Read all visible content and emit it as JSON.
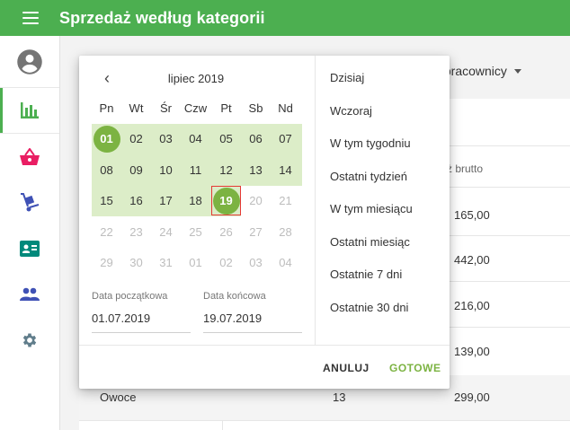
{
  "header": {
    "title": "Sprzedaż według kategorii"
  },
  "sidebar": {
    "items": [
      {
        "icon": "account-circle-icon",
        "active": false
      },
      {
        "icon": "bar-chart-icon",
        "active": true
      },
      {
        "icon": "basket-icon",
        "active": false
      },
      {
        "icon": "hand-truck-icon",
        "active": false
      },
      {
        "icon": "id-card-icon",
        "active": false
      },
      {
        "icon": "people-icon",
        "active": false
      },
      {
        "icon": "gear-icon",
        "active": false
      }
    ]
  },
  "background": {
    "employees_select": "cy pracownicy",
    "column_header": "ż brutto",
    "values": [
      "165,00",
      "442,00",
      "216,00",
      "139,00",
      "299,00"
    ],
    "last_row": {
      "category": "Owoce",
      "qty": "13",
      "value": "299,00"
    }
  },
  "calendar": {
    "month_label": "lipiec 2019",
    "prev_icon": "‹",
    "weekdays": [
      "Pn",
      "Wt",
      "Śr",
      "Czw",
      "Pt",
      "Sb",
      "Nd"
    ],
    "weeks": [
      [
        "01",
        "02",
        "03",
        "04",
        "05",
        "06",
        "07"
      ],
      [
        "08",
        "09",
        "10",
        "11",
        "12",
        "13",
        "14"
      ],
      [
        "15",
        "16",
        "17",
        "18",
        "19",
        "20",
        "21"
      ],
      [
        "22",
        "23",
        "24",
        "25",
        "26",
        "27",
        "28"
      ],
      [
        "29",
        "30",
        "31",
        "01",
        "02",
        "03",
        "04"
      ]
    ],
    "range_start": "01",
    "range_end": "19",
    "start_label": "Data początkowa",
    "start_value": "01.07.2019",
    "end_label": "Data końcowa",
    "end_value": "19.07.2019"
  },
  "presets": [
    "Dzisiaj",
    "Wczoraj",
    "W tym tygodniu",
    "Ostatni tydzień",
    "W tym miesiącu",
    "Ostatni miesiąc",
    "Ostatnie 7 dni",
    "Ostatnie 30 dni"
  ],
  "actions": {
    "cancel": "ANULUJ",
    "ok": "GOTOWE"
  },
  "colors": {
    "primary": "#4caf50",
    "accent": "#7cb342",
    "range": "#dcedc8",
    "icon_pink": "#e91e63",
    "icon_blue": "#3f51b5",
    "icon_teal": "#00897b",
    "icon_grey": "#607d8b"
  }
}
